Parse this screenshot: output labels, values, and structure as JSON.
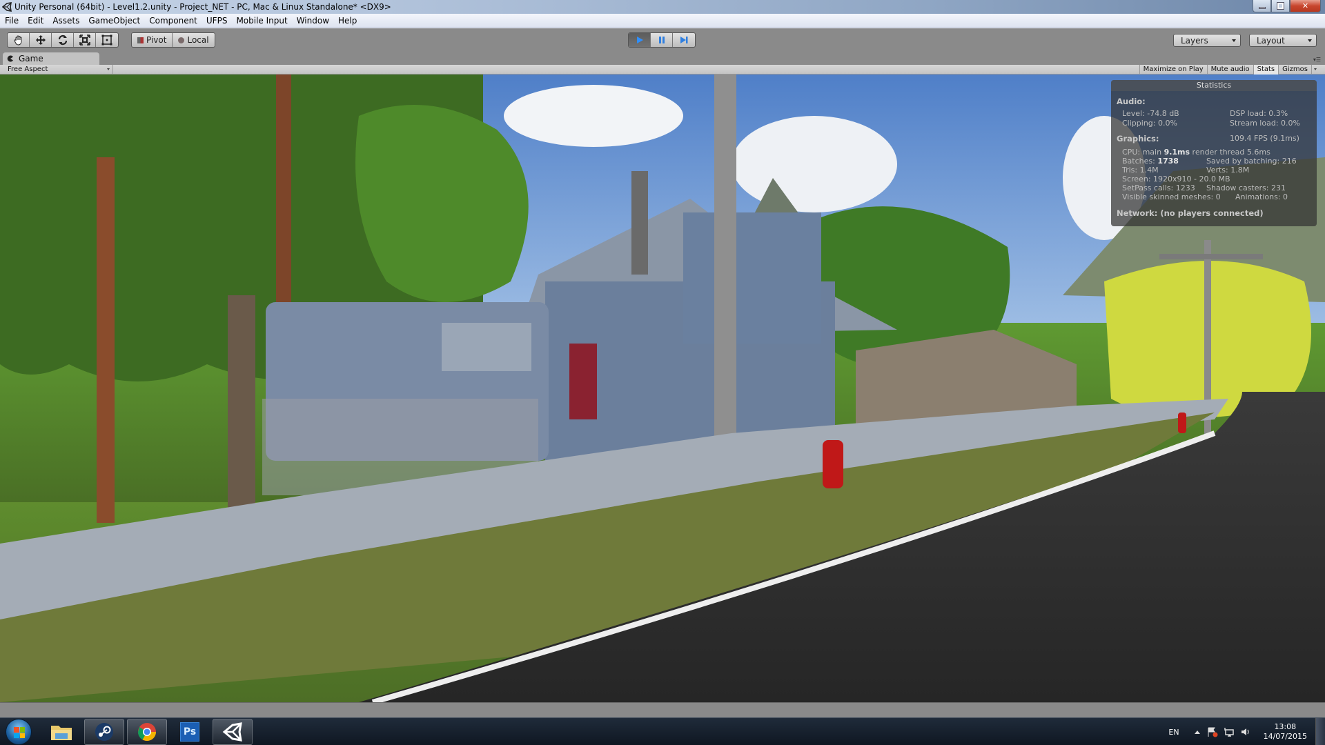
{
  "window": {
    "title": "Unity Personal (64bit) - Level1.2.unity - Project_NET - PC, Mac & Linux Standalone* <DX9>",
    "controls": [
      "minimize",
      "restore",
      "close"
    ]
  },
  "menubar": {
    "items": [
      "File",
      "Edit",
      "Assets",
      "GameObject",
      "Component",
      "UFPS",
      "Mobile Input",
      "Window",
      "Help"
    ]
  },
  "toolbar": {
    "transform_tools": [
      "hand-tool",
      "move-tool",
      "rotate-tool",
      "scale-tool",
      "rect-tool"
    ],
    "pivot_label": "Pivot",
    "local_label": "Local",
    "play_state": "playing",
    "layers_label": "Layers",
    "layout_label": "Layout"
  },
  "game_panel": {
    "tab_label": "Game",
    "aspect_label": "Free Aspect",
    "buttons": [
      {
        "label": "Maximize on Play",
        "active": false
      },
      {
        "label": "Mute audio",
        "active": false
      },
      {
        "label": "Stats",
        "active": true
      },
      {
        "label": "Gizmos",
        "active": false
      }
    ]
  },
  "stats": {
    "title": "Statistics",
    "audio_header": "Audio:",
    "level": "Level: -74.8 dB",
    "clipping": "Clipping: 0.0%",
    "dsp_load": "DSP load: 0.3%",
    "stream_load": "Stream load: 0.0%",
    "graphics_header": "Graphics:",
    "fps": "109.4 FPS (9.1ms)",
    "cpu_prefix": "CPU: main ",
    "cpu_main": "9.1ms",
    "cpu_render": "  render thread 5.6ms",
    "batches_prefix": "Batches: ",
    "batches": "1738",
    "saved_batching": "Saved by batching: 216",
    "tris": "Tris: 1.4M",
    "verts": "Verts: 1.8M",
    "screen": "Screen: 1920x910 - 20.0 MB",
    "setpass": "SetPass calls: 1233",
    "shadow_casters": "Shadow casters: 231",
    "skinned": "Visible skinned meshes: 0",
    "animations": "Animations: 0",
    "network": "Network: (no players connected)"
  },
  "taskbar": {
    "apps": [
      {
        "name": "Windows Explorer",
        "open": false
      },
      {
        "name": "Steam",
        "open": true
      },
      {
        "name": "Google Chrome",
        "open": true
      },
      {
        "name": "Photoshop",
        "open": false,
        "label": "Ps"
      },
      {
        "name": "Unity",
        "open": true
      }
    ],
    "language": "EN",
    "time": "13:08",
    "date": "14/07/2015"
  }
}
